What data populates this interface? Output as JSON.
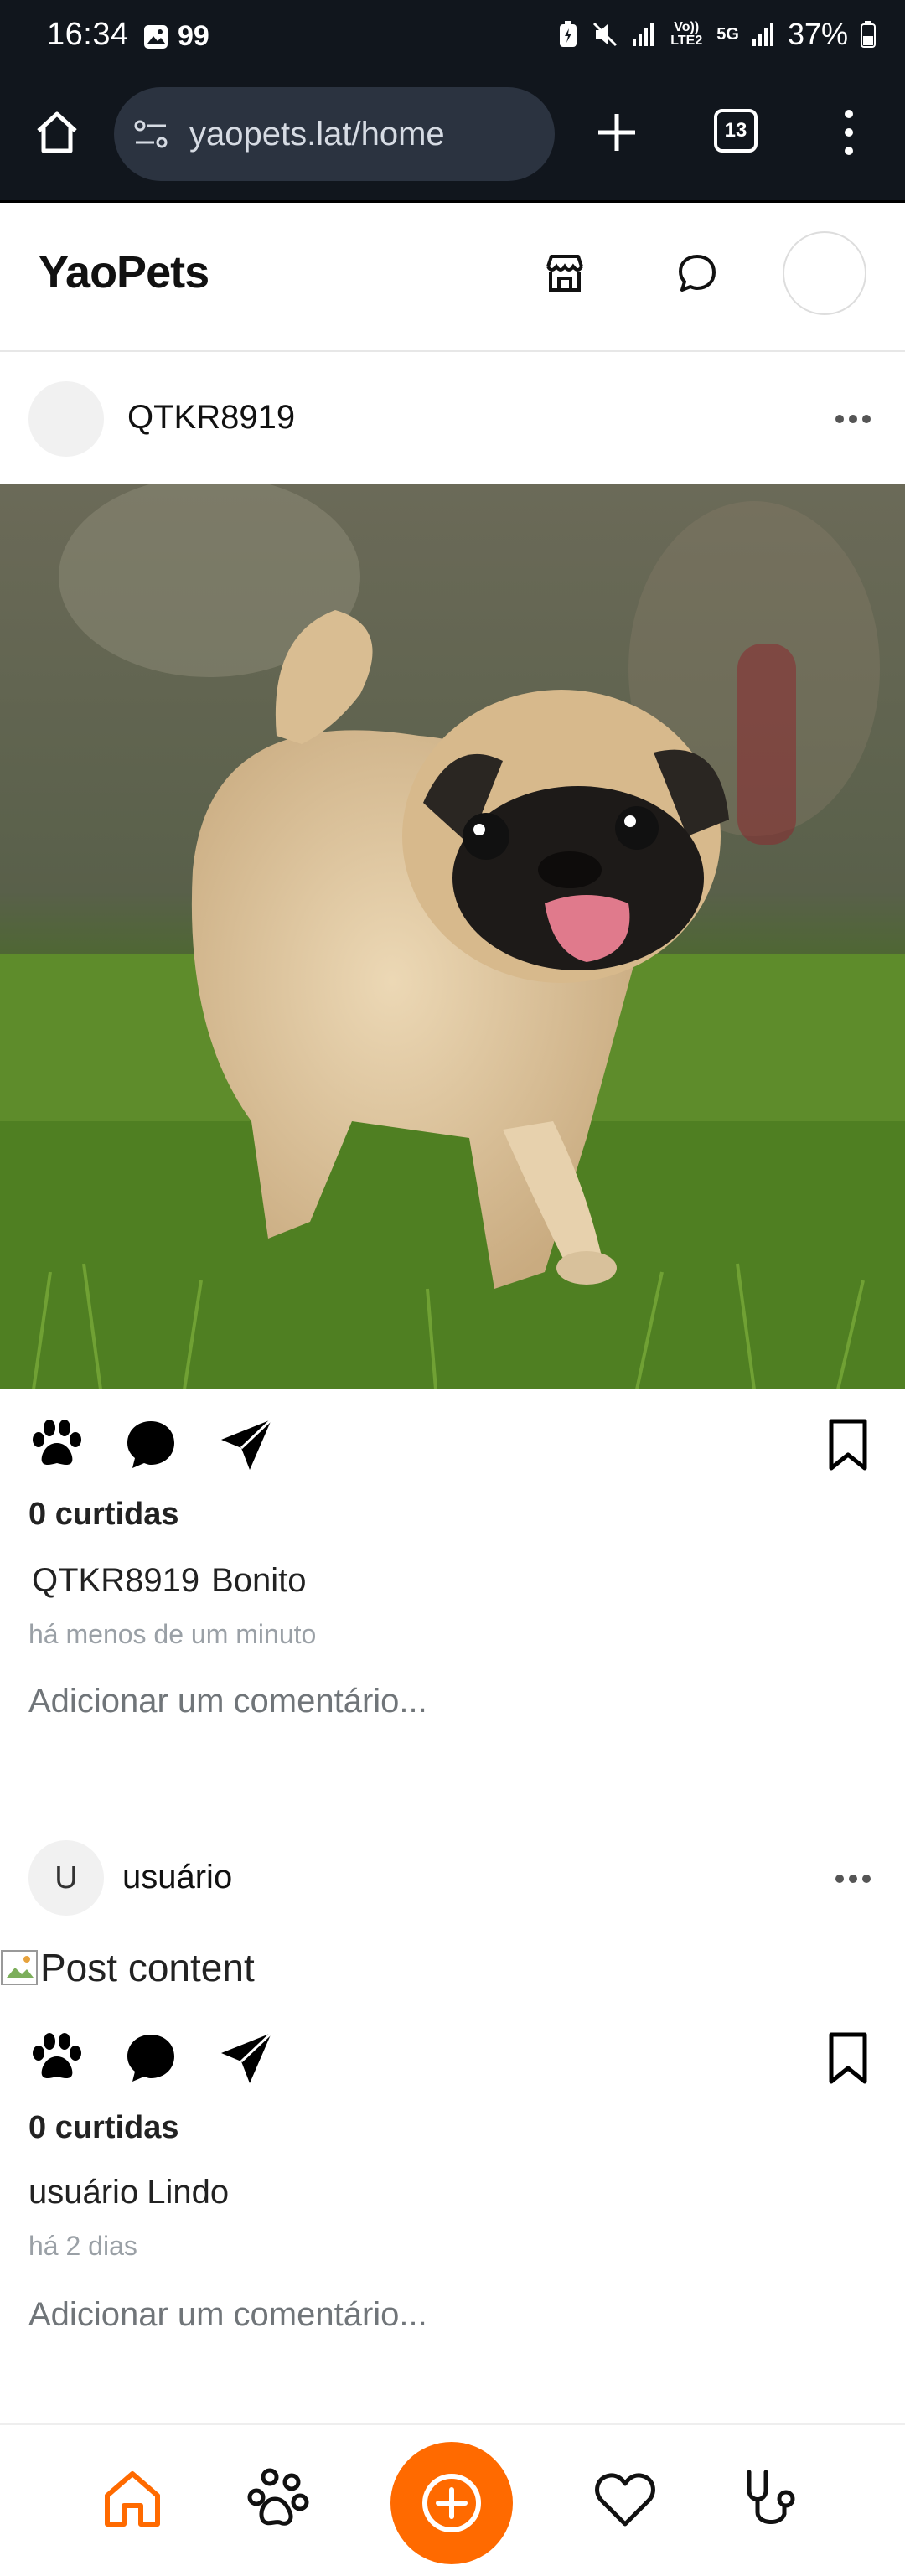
{
  "status_bar": {
    "time": "16:34",
    "notif_count": "99",
    "volte_label": "Vo)) LTE2",
    "network_label": "5G",
    "battery": "37%"
  },
  "browser": {
    "url": "yaopets.lat/home",
    "tab_count": "13"
  },
  "app": {
    "brand": "YaoPets",
    "accent_color": "#ff6a00"
  },
  "posts": [
    {
      "username": "QTKR8919",
      "avatar_letter": "",
      "likes": "0 curtidas",
      "caption_user": "QTKR8919",
      "caption_text": "Bonito",
      "time_ago": "há menos de um minuto",
      "comment_placeholder": "Adicionar um comentário..."
    },
    {
      "username": "usuário",
      "avatar_letter": "U",
      "image_alt": "Post content",
      "likes": "0 curtidas",
      "caption_user": "usuário",
      "caption_text": "Lindo",
      "time_ago": "há 2 dias",
      "comment_placeholder": "Adicionar um comentário..."
    }
  ],
  "bottom_nav": [
    "home-icon",
    "paw-icon",
    "add-post-icon",
    "heart-icon",
    "stethoscope-icon"
  ]
}
